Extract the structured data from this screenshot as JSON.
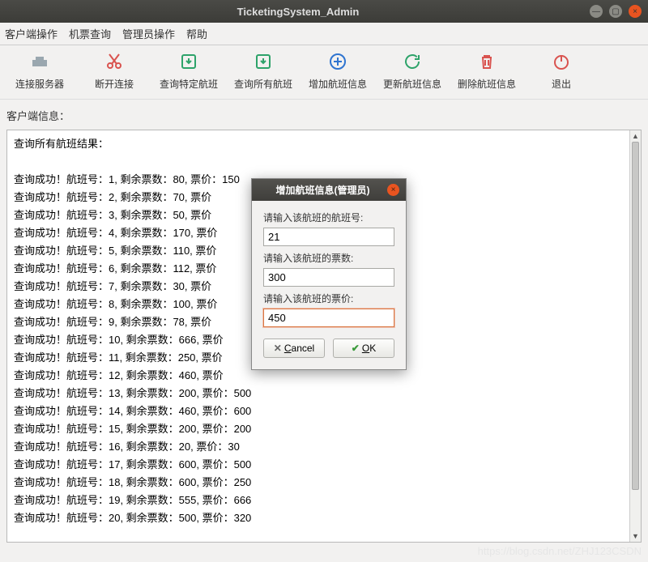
{
  "window": {
    "title": "TicketingSystem_Admin"
  },
  "menu": {
    "items": [
      "客户端操作",
      "机票查询",
      "管理员操作",
      "帮助"
    ]
  },
  "toolbar": {
    "items": [
      {
        "label": "连接服务器",
        "name": "connect-server-button",
        "icon": "server-icon",
        "color": "#9aa7af"
      },
      {
        "label": "断开连接",
        "name": "disconnect-button",
        "icon": "cut-icon",
        "color": "#d9534f"
      },
      {
        "label": "查询特定航班",
        "name": "query-specific-flight-button",
        "icon": "download-box-icon",
        "color": "#2ea36a"
      },
      {
        "label": "查询所有航班",
        "name": "query-all-flights-button",
        "icon": "download-box-icon",
        "color": "#2ea36a"
      },
      {
        "label": "增加航班信息",
        "name": "add-flight-button",
        "icon": "plus-circle-icon",
        "color": "#2f74d0"
      },
      {
        "label": "更新航班信息",
        "name": "update-flight-button",
        "icon": "refresh-icon",
        "color": "#2ea36a"
      },
      {
        "label": "删除航班信息",
        "name": "delete-flight-button",
        "icon": "trash-icon",
        "color": "#d9534f"
      },
      {
        "label": "退出",
        "name": "exit-button",
        "icon": "power-icon",
        "color": "#d9534f"
      }
    ]
  },
  "section": {
    "label": "客户端信息："
  },
  "results": {
    "header": "查询所有航班结果：",
    "rows": [
      "查询成功！航班号：1, 剩余票数：80, 票价：150",
      "查询成功！航班号：2, 剩余票数：70, 票价",
      "查询成功！航班号：3, 剩余票数：50, 票价",
      "查询成功！航班号：4, 剩余票数：170, 票价",
      "查询成功！航班号：5, 剩余票数：110, 票价",
      "查询成功！航班号：6, 剩余票数：112, 票价",
      "查询成功！航班号：7, 剩余票数：30, 票价",
      "查询成功！航班号：8, 剩余票数：100, 票价",
      "查询成功！航班号：9, 剩余票数：78, 票价",
      "查询成功！航班号：10, 剩余票数：666, 票价",
      "查询成功！航班号：11, 剩余票数：250, 票价",
      "查询成功！航班号：12, 剩余票数：460, 票价",
      "查询成功！航班号：13, 剩余票数：200, 票价：500",
      "查询成功！航班号：14, 剩余票数：460, 票价：600",
      "查询成功！航班号：15, 剩余票数：200, 票价：200",
      "查询成功！航班号：16, 剩余票数：20, 票价：30",
      "查询成功！航班号：17, 剩余票数：600, 票价：500",
      "查询成功！航班号：18, 剩余票数：600, 票价：250",
      "查询成功！航班号：19, 剩余票数：555, 票价：666",
      "查询成功！航班号：20, 剩余票数：500, 票价：320"
    ]
  },
  "dialog": {
    "title": "增加航班信息(管理员)",
    "label_flight_no": "请输入该航班的航班号:",
    "value_flight_no": "21",
    "label_tickets": "请输入该航班的票数:",
    "value_tickets": "300",
    "label_price": "请输入该航班的票价:",
    "value_price": "450",
    "cancel": "Cancel",
    "ok": "OK"
  },
  "watermark": "https://blog.csdn.net/ZHJ123CSDN"
}
